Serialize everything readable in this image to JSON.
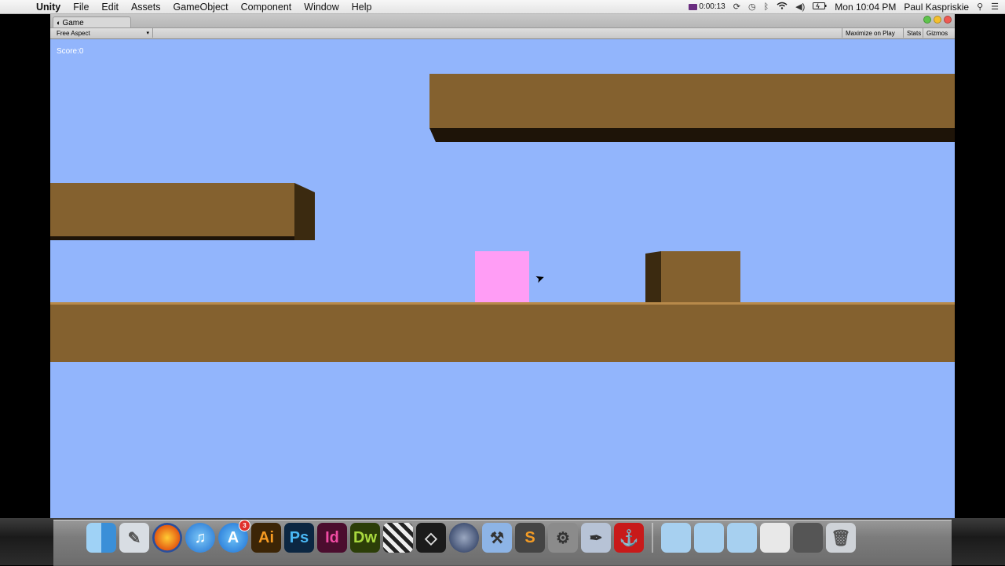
{
  "menubar": {
    "app_name": "Unity",
    "items": [
      "File",
      "Edit",
      "Assets",
      "GameObject",
      "Component",
      "Window",
      "Help"
    ],
    "recording_time": "0:00:13",
    "clock": "Mon 10:04 PM",
    "user": "Paul Kaspriskie",
    "status_icons": [
      "screen-recorder-icon",
      "sync-icon",
      "time-machine-icon",
      "bluetooth-icon",
      "wifi-icon",
      "volume-icon",
      "battery-icon",
      "spotlight-search-icon",
      "notification-center-icon"
    ]
  },
  "window": {
    "tab_label": "Game",
    "aspect": "Free Aspect",
    "toolbar_buttons": [
      "Maximize on Play",
      "Stats",
      "Gizmos"
    ]
  },
  "game": {
    "score_text": "Score:0",
    "colors": {
      "sky": "#92b5fc",
      "platform": "#84612f",
      "platform_shadow": "#1e1408",
      "platform_side": "#3b2a10",
      "player": "#ff9df5"
    }
  },
  "dock": {
    "icons": [
      "finder-icon",
      "preview-icon",
      "firefox-icon",
      "itunes-icon",
      "app-store-icon",
      "illustrator-icon",
      "photoshop-icon",
      "indesign-icon",
      "dreamweaver-icon",
      "final-cut-icon",
      "unity-icon",
      "cinema4d-icon",
      "xcode-icon",
      "sublime-text-icon",
      "system-preferences-icon",
      "script-editor-icon",
      "acrobat-icon"
    ],
    "app_store_badge": "3",
    "tile_labels": {
      "illustrator": "Ai",
      "photoshop": "Ps",
      "indesign": "Id",
      "dreamweaver": "Dw"
    }
  }
}
